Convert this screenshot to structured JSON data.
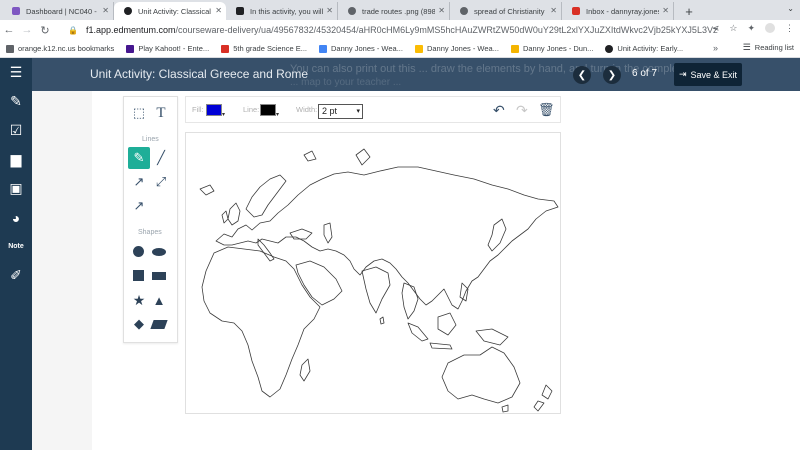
{
  "browser": {
    "tabs": [
      {
        "title": "Dashboard | NC040 - C",
        "color": "#7e57c2"
      },
      {
        "title": "Unit Activity: Classical",
        "color": "#202124"
      },
      {
        "title": "In this activity, you will",
        "color": "#202124"
      },
      {
        "title": "trade routes .png (898",
        "color": "#5f6368"
      },
      {
        "title": "spread of Christianity",
        "color": "#5f6368"
      },
      {
        "title": "Inbox - dannyray.jones",
        "color": "#d93025"
      }
    ],
    "url_domain": "f1.app.edmentum.com",
    "url_path": "/courseware-delivery/ua/49567832/45320454/aHR0cHM6Ly9mMS5hcHAuZWRtZW50dW0uY29tL2xlYXJuZXItdWkvc2Vjb25kYXJ5L3VzZXItYX",
    "bookmarks": [
      {
        "label": "orange.k12.nc.us bookmarks",
        "color": "#3c4043"
      },
      {
        "label": "Play Kahoot! - Ente...",
        "color": "#46178f"
      },
      {
        "label": "5th grade Science E...",
        "color": "#d93025"
      },
      {
        "label": "Danny Jones - Wea...",
        "color": "#4285f4"
      },
      {
        "label": "Danny Jones - Wea...",
        "color": "#fbbc04"
      },
      {
        "label": "Danny Jones - Dun...",
        "color": "#f4b400"
      },
      {
        "label": "Unit Activity: Early...",
        "color": "#202124"
      }
    ],
    "reading_list": "Reading list"
  },
  "header": {
    "title": "Unit Activity: Classical Greece and Rome",
    "ghost_line1": "You can also print out this ... draw the elements by hand, and turn in the completed ...",
    "ghost_line2": "... map to your teacher ...",
    "page_current": "6",
    "page_of": "of",
    "page_total": "7",
    "save_exit": "Save & Exit"
  },
  "toolbar": {
    "section_lines": "Lines",
    "section_shapes": "Shapes",
    "text_tool": "T"
  },
  "options": {
    "fill_label": "Fill:",
    "fill_color": "#0000d6",
    "line_label": "Line:",
    "line_color": "#000000",
    "width_label": "Width:",
    "width_value": "2 pt"
  },
  "colors": {
    "sidebar": "#1e3a52",
    "header": "#37506a",
    "active_tool": "#1eae98"
  }
}
